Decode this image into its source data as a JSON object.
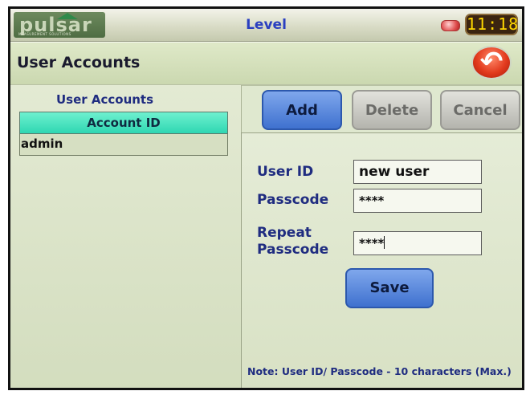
{
  "app": {
    "logo_text": "pulsar",
    "logo_subtext": "MEASUREMENT SOLUTIONS",
    "screen_title": "Level",
    "clock": "11:18",
    "status_led_color": "#e05050"
  },
  "header": {
    "title": "User Accounts",
    "back_icon": "back-arrow-icon"
  },
  "accounts_list": {
    "title": "User Accounts",
    "column_header": "Account ID",
    "rows": [
      "admin"
    ]
  },
  "toolbar": {
    "add_label": "Add",
    "delete_label": "Delete",
    "cancel_label": "Cancel"
  },
  "form": {
    "user_id_label": "User ID",
    "user_id_value": "new user",
    "passcode_label": "Passcode",
    "passcode_value": "****",
    "repeat_label_line1": "Repeat",
    "repeat_label_line2": "Passcode",
    "repeat_value": "****",
    "save_label": "Save",
    "note": "Note: User ID/ Passcode - 10 characters (Max.)"
  }
}
